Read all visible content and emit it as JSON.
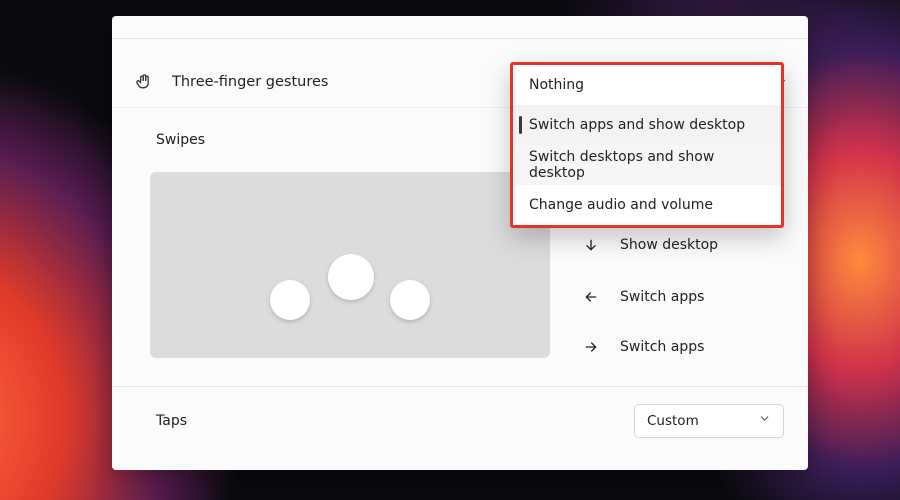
{
  "section": {
    "title": "Three-finger gestures"
  },
  "swipes": {
    "label": "Swipes"
  },
  "actions": {
    "down": "Show desktop",
    "left": "Switch apps",
    "right": "Switch apps"
  },
  "taps": {
    "label": "Taps",
    "dropdown_value": "Custom"
  },
  "popup": {
    "options": [
      "Nothing",
      "Switch apps and show desktop",
      "Switch desktops and show desktop",
      "Change audio and volume"
    ],
    "selected_index": 1
  },
  "colors": {
    "highlight_box": "#e6332a"
  }
}
